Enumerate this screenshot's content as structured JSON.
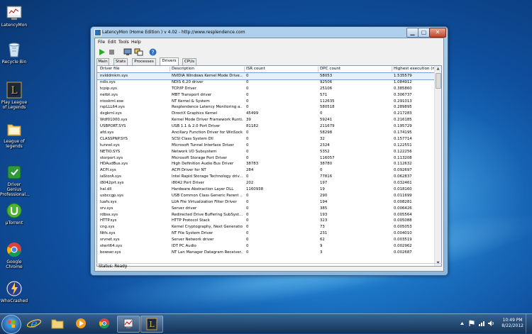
{
  "desktop": {
    "icons": [
      {
        "label": "LatencyMon",
        "icon": "latencymon-icon"
      },
      {
        "label": "Recycle Bin",
        "icon": "recycle-bin-icon"
      },
      {
        "label": "Play League of Legends",
        "icon": "league-of-legends-icon"
      },
      {
        "label": "League of legends",
        "icon": "folder-icon"
      },
      {
        "label": "Driver Genius Professional...",
        "icon": "driver-genius-icon"
      },
      {
        "label": "µTorrent",
        "icon": "utorrent-icon"
      },
      {
        "label": "Google Chrome",
        "icon": "chrome-icon"
      },
      {
        "label": "WhoCrashed",
        "icon": "whocrashed-icon"
      }
    ]
  },
  "window": {
    "title": "LatencyMon  (Home Edition )  v 4.02 - http://www.resplendence.com",
    "menu": [
      "File",
      "Edit",
      "Tools",
      "Help"
    ],
    "tabs": [
      "Main",
      "Stats",
      "Processes",
      "Drivers",
      "CPUs"
    ],
    "active_tab": "Drivers",
    "columns": [
      "Driver file",
      "Description",
      "ISR count",
      "DPC count",
      "Highest execution (ms)"
    ],
    "rows": [
      [
        "nvlddmkm.sys",
        "NVIDIA Windows Kernel Mode Drive...",
        "0",
        "58053",
        "1.535579"
      ],
      [
        "ndis.sys",
        "NDIS 6.20 driver",
        "0",
        "92506",
        "1.084912"
      ],
      [
        "tcpip.sys",
        "TCP/IP Driver",
        "0",
        "25106",
        "0.385860"
      ],
      [
        "netbt.sys",
        "MBT Transport driver",
        "0",
        "571",
        "0.306737"
      ],
      [
        "ntoskrnl.exe",
        "NT Kernel & System",
        "0",
        "112635",
        "0.291013"
      ],
      [
        "rspLLL64.sys",
        "Resplendence Latency Monitoring a...",
        "0",
        "580518",
        "0.289895"
      ],
      [
        "dxgkrnl.sys",
        "DirectX Graphics Kernel",
        "45499",
        "0",
        "0.217283"
      ],
      [
        "Wdf01000.sys",
        "Kernel Mode Driver Framework Runti...",
        "39",
        "59241",
        "0.216185"
      ],
      [
        "USBPORT.SYS",
        "USB 1.1 & 2.0 Port Driver",
        "81182",
        "211679",
        "0.195729"
      ],
      [
        "afd.sys",
        "Ancillary Function Driver for WinSock",
        "0",
        "58298",
        "0.174195"
      ],
      [
        "CLASSPNP.SYS",
        "SCSI Class System Dll",
        "0",
        "32",
        "0.157714"
      ],
      [
        "tunnel.sys",
        "Microsoft Tunnel Interface Driver",
        "0",
        "2324",
        "0.122551"
      ],
      [
        "NETIO.SYS",
        "Network I/O Subsystem",
        "0",
        "5352",
        "0.122256"
      ],
      [
        "storport.sys",
        "Microsoft Storage Port Driver",
        "0",
        "116057",
        "0.113208"
      ],
      [
        "HDAudBus.sys",
        "High Definition Audio Bus Driver",
        "38783",
        "38780",
        "0.112632"
      ],
      [
        "ACPI.sys",
        "ACPI Driver for NT",
        "284",
        "0",
        "0.092697"
      ],
      [
        "iaStorA.sys",
        "Intel Rapid Storage Technology driv...",
        "0",
        "77816",
        "0.062837"
      ],
      [
        "i8042prt.sys",
        "i8042 Port Driver",
        "202",
        "197",
        "0.032461"
      ],
      [
        "hal.dll",
        "Hardware Abstraction Layer DLL",
        "1160938",
        "19",
        "0.018160"
      ],
      [
        "usbccgp.sys",
        "USB Common Class Generic Parent ...",
        "0",
        "290",
        "0.011699"
      ],
      [
        "luafv.sys",
        "LUA File Virtualization Filter Driver",
        "0",
        "194",
        "0.008281"
      ],
      [
        "srv.sys",
        "Server driver",
        "0",
        "385",
        "0.006426"
      ],
      [
        "rdbss.sys",
        "Redirected Drive Buffering SubSyst...",
        "0",
        "193",
        "0.005564"
      ],
      [
        "HTTP.sys",
        "HTTP Protocol Stack",
        "0",
        "323",
        "0.005088"
      ],
      [
        "cng.sys",
        "Kernel Cryptography, Next Generation",
        "0",
        "73",
        "0.005053"
      ],
      [
        "Ntfs.sys",
        "NT File System Driver",
        "0",
        "231",
        "0.004010"
      ],
      [
        "srvnet.sys",
        "Server Network driver",
        "0",
        "62",
        "0.003519"
      ],
      [
        "stwrt64.sys",
        "IDT PC Audio",
        "0",
        "9",
        "0.002962"
      ],
      [
        "bowser.sys",
        "NT Lan Manager Datagram Receiver...",
        "0",
        "3",
        "0.002687"
      ]
    ],
    "status": "Status: Ready"
  },
  "taskbar": {
    "time": "10:49 PM",
    "date": "8/22/2012",
    "pinned": [
      "ie-icon",
      "explorer-folder-icon",
      "media-player-icon",
      "chrome-icon",
      "latencymon-icon",
      "league-of-legends-icon"
    ]
  }
}
